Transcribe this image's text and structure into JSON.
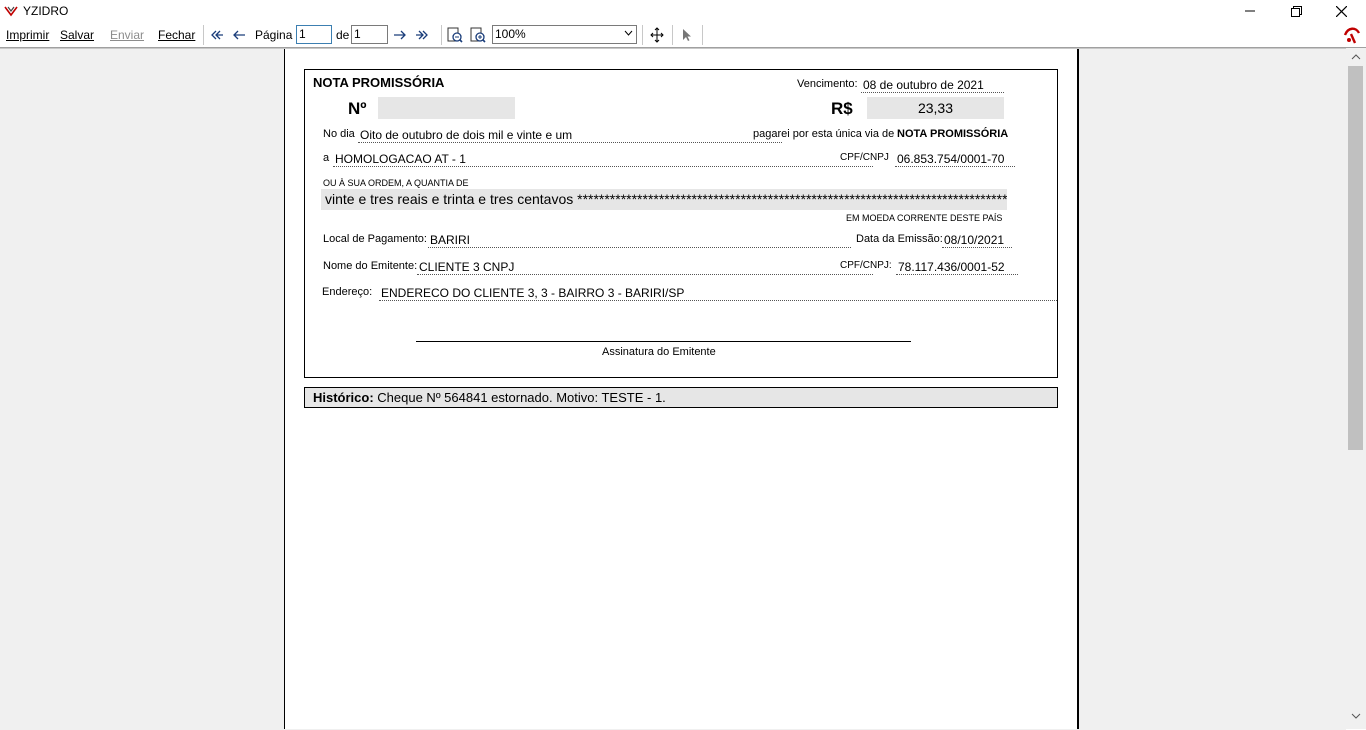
{
  "window": {
    "title": "YZIDRO"
  },
  "toolbar": {
    "print_label": "Imprimir",
    "save_label": "Salvar",
    "send_label": "Enviar",
    "close_label": "Fechar",
    "page_label": "Página",
    "page_value": "1",
    "of_label": "de",
    "page_total": "1",
    "zoom_value": "100%"
  },
  "note": {
    "title": "NOTA PROMISSÓRIA",
    "vencimento_label": "Vencimento:",
    "vencimento_value": "08 de outubro de 2021",
    "numero_label": "Nº",
    "numero_value": "",
    "valor_label": "R$",
    "valor_value": "23,33",
    "nodia_label": "No dia",
    "nodia_value": "Oito de outubro de dois mil e vinte e um",
    "pagarei_text": "pagarei por esta única via de",
    "pagarei_bold": "NOTA PROMISSÓRIA",
    "a_label": "a",
    "beneficiario": "HOMOLOGACAO AT - 1",
    "cpf1_label": "CPF/CNPJ",
    "cpf1_value": "06.853.754/0001-70",
    "ordem_label": "OU À SUA ORDEM, A QUANTIA DE",
    "quantia_text": "vinte e tres reais  e trinta e tres centavos ********************************************************************************",
    "moeda_text": "EM MOEDA CORRENTE DESTE PAÍS",
    "local_label": "Local de Pagamento:",
    "local_value": "BARIRI",
    "emissao_label": "Data da Emissão:",
    "emissao_value": "08/10/2021",
    "emitente_label": "Nome do Emitente:",
    "emitente_value": "CLIENTE 3 CNPJ",
    "cpf2_label": "CPF/CNPJ:",
    "cpf2_value": "78.117.436/0001-52",
    "endereco_label": "Endereço:",
    "endereco_value": "ENDERECO DO CLIENTE 3, 3 - BAIRRO 3 - BARIRI/SP",
    "assinatura_label": "Assinatura do Emitente"
  },
  "historico": {
    "label": "Histórico:",
    "text": " Cheque Nº 564841 estornado. Motivo: TESTE - 1."
  },
  "colors": {
    "accent_icon": "#c00000",
    "shade": "#e6e6e6"
  }
}
